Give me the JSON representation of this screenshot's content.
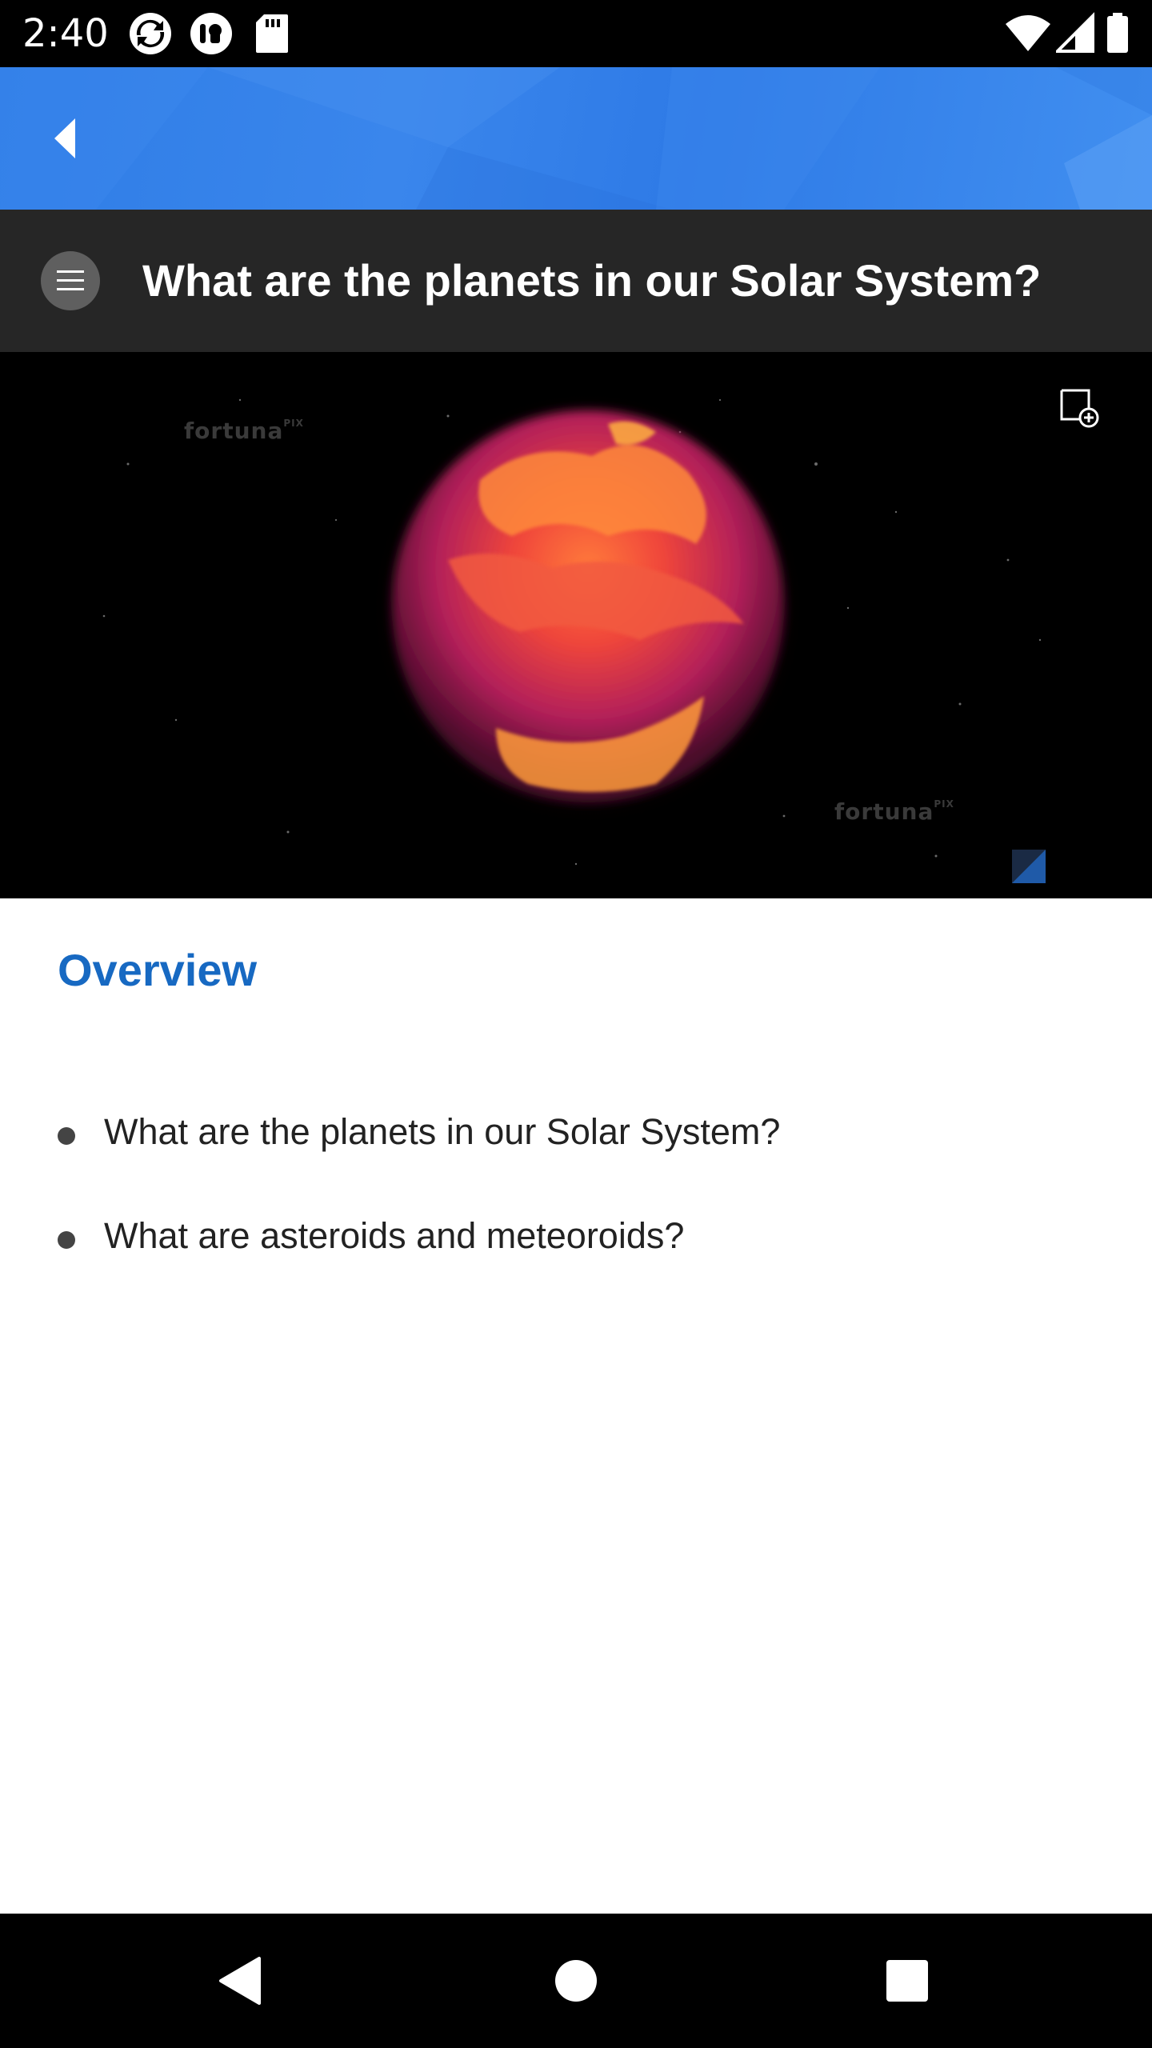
{
  "status_bar": {
    "time": "2:40",
    "icons": [
      "sync-icon",
      "app-notification-icon",
      "sd-card-icon",
      "wifi-icon",
      "cellular-signal-icon",
      "battery-icon"
    ]
  },
  "app_bar": {
    "back_icon": "back-arrow-icon"
  },
  "title_bar": {
    "menu_icon": "hamburger-menu-icon",
    "title": "What are the planets in our Solar System?"
  },
  "media": {
    "watermark_1": "fortuna",
    "watermark_1_sup": "PIX",
    "watermark_2": "fortuna",
    "watermark_2_sup": "PIX",
    "add_note_icon": "add-note-icon"
  },
  "content": {
    "heading": "Overview",
    "items": [
      {
        "label": "What are the planets in our Solar System?"
      },
      {
        "label": "What are asteroids and meteoroids?"
      }
    ]
  },
  "nav_bar": {
    "back_icon": "nav-back-icon",
    "home_icon": "nav-home-icon",
    "recents_icon": "nav-recents-icon"
  },
  "colors": {
    "accent_blue": "#2f7de6",
    "heading_blue": "#1769c2",
    "title_bar_bg": "#262626"
  }
}
